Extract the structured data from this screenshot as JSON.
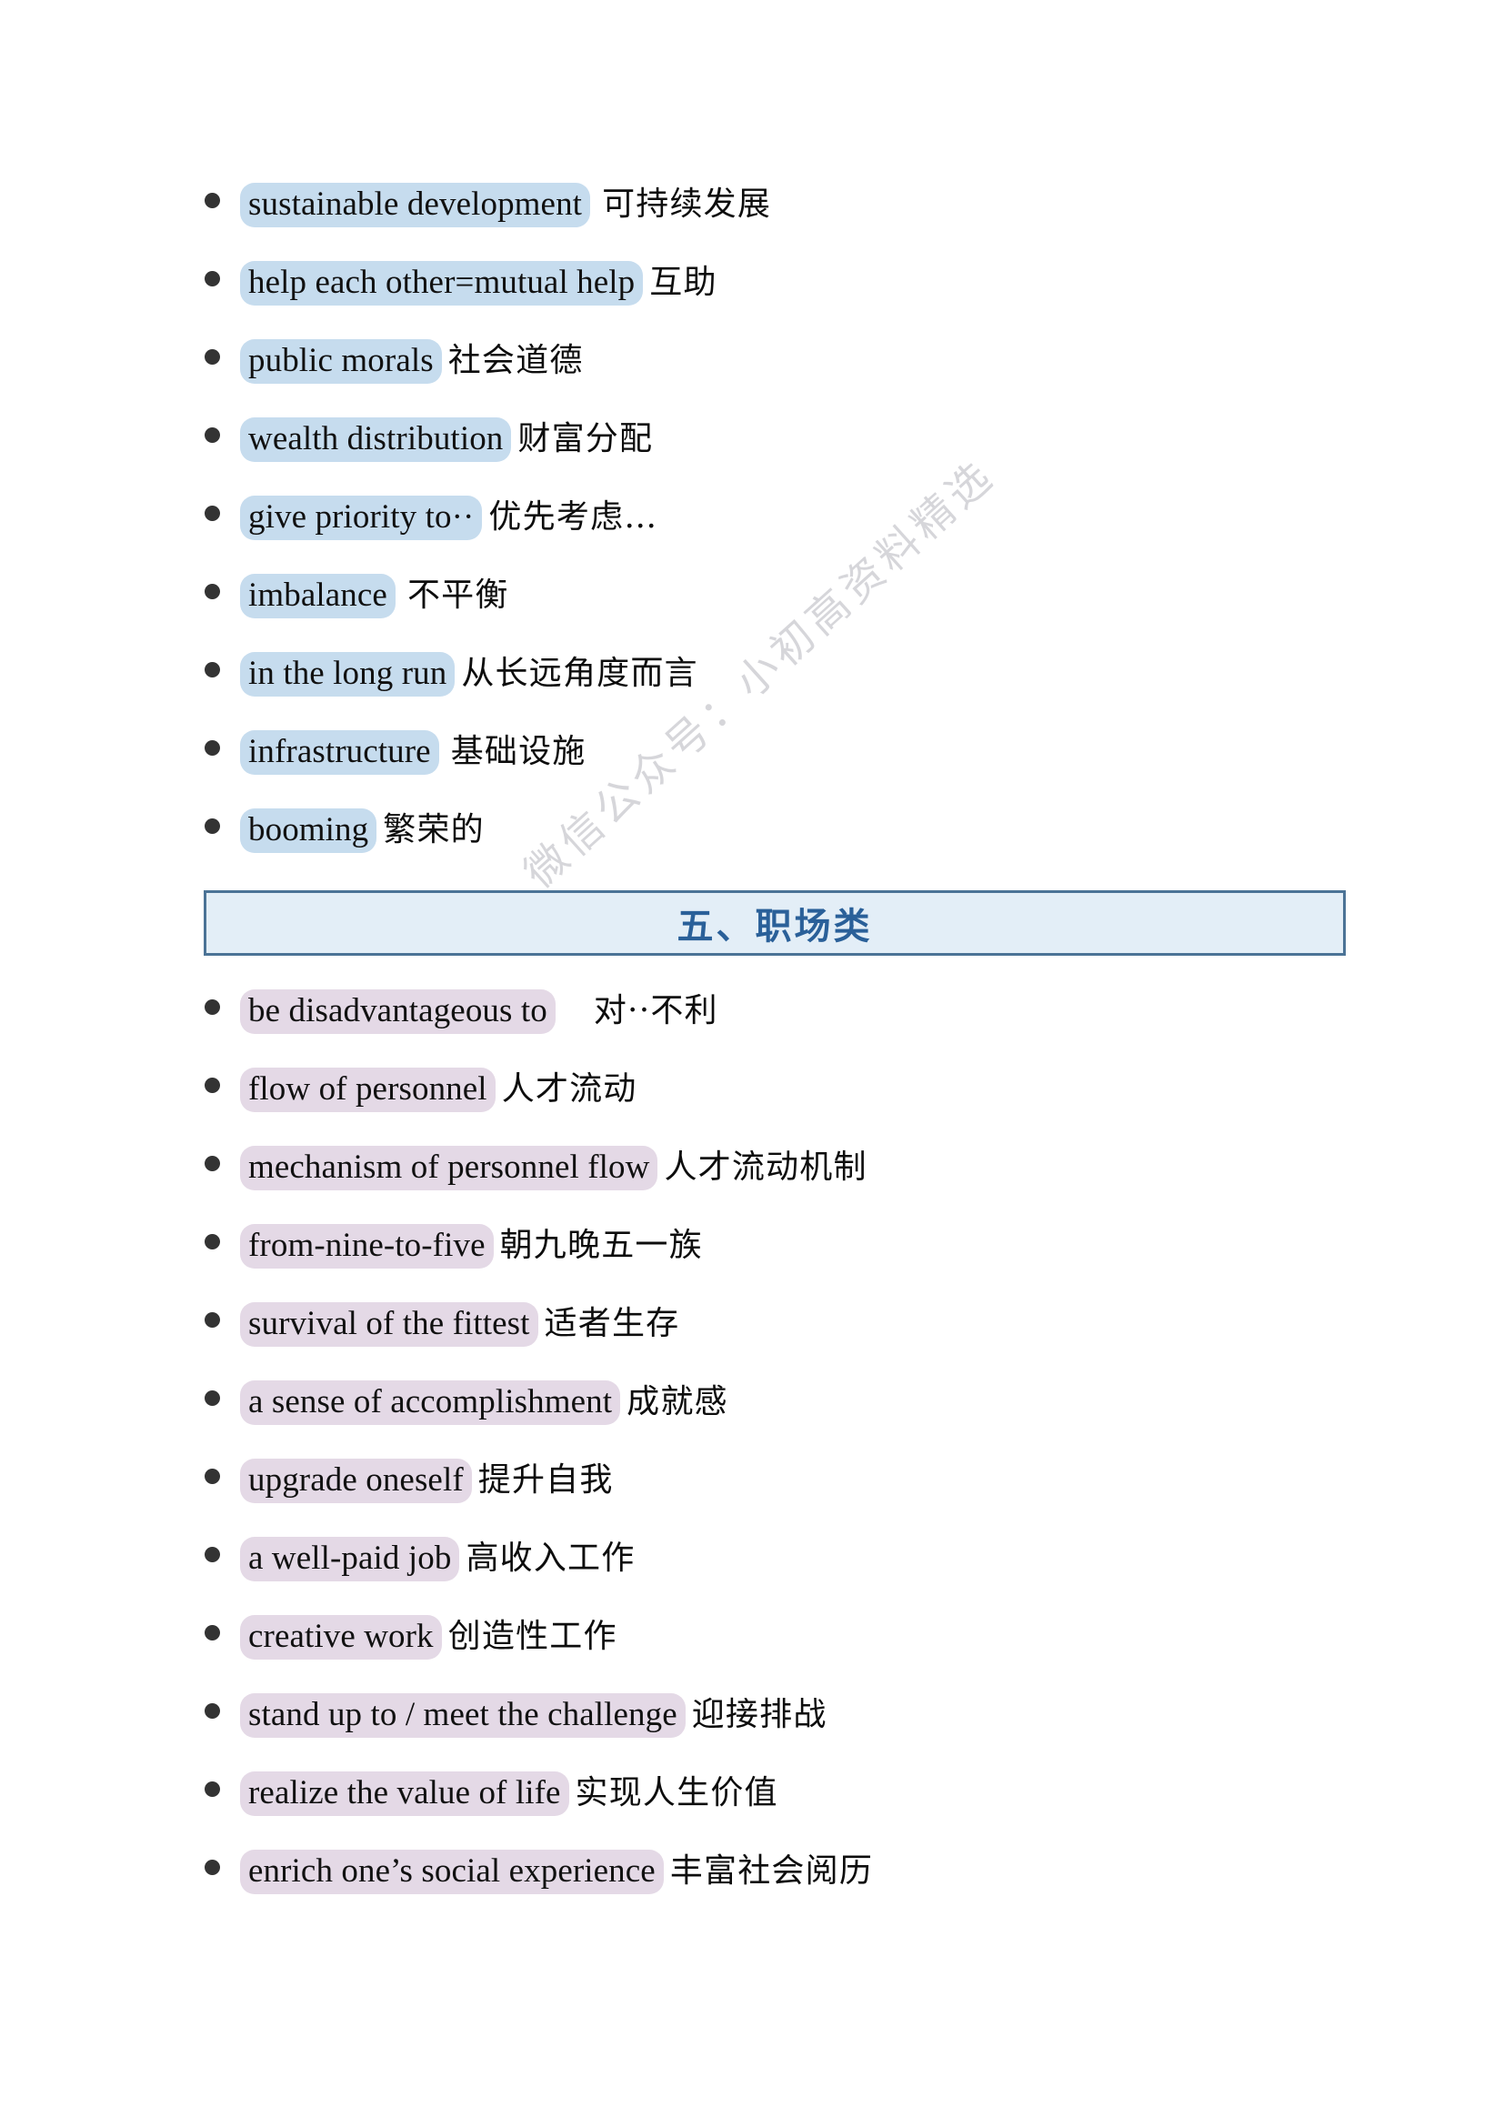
{
  "document": {
    "watermark": "微信公众号：小初高资料精选"
  },
  "section_one": {
    "items": [
      {
        "term": "sustainable development",
        "gloss": "可持续发展",
        "highlight": "blue",
        "gap": "normal"
      },
      {
        "term": "help each other=mutual help",
        "gloss": "互助",
        "highlight": "blue",
        "gap": "small"
      },
      {
        "term": "public morals",
        "gloss": "社会道德",
        "highlight": "blue",
        "gap": "small"
      },
      {
        "term": "wealth distribution",
        "gloss": "财富分配",
        "highlight": "blue",
        "gap": "small"
      },
      {
        "term": "give priority to··",
        "gloss": "优先考虑…",
        "highlight": "blue",
        "gap": "small"
      },
      {
        "term": "imbalance",
        "gloss": "不平衡",
        "highlight": "blue",
        "gap": "normal"
      },
      {
        "term": "in the long run",
        "gloss": "从长远角度而言",
        "highlight": "blue",
        "gap": "small"
      },
      {
        "term": "infrastructure",
        "gloss": "基础设施",
        "highlight": "blue",
        "gap": "normal"
      },
      {
        "term": "booming",
        "gloss": "繁荣的",
        "highlight": "blue",
        "gap": "small"
      }
    ]
  },
  "section_five": {
    "title": "五、职场类",
    "items": [
      {
        "term": "be disadvantageous to",
        "gloss": "对··不利",
        "highlight": "violet",
        "gap": "wide"
      },
      {
        "term": "flow of personnel",
        "gloss": "人才流动",
        "highlight": "violet",
        "gap": "small"
      },
      {
        "term": "mechanism of personnel flow",
        "gloss": "人才流动机制",
        "highlight": "violet",
        "gap": "small"
      },
      {
        "term": "from-nine-to-five",
        "gloss": "朝九晚五一族",
        "highlight": "violet",
        "gap": "small"
      },
      {
        "term": "survival of the fittest",
        "gloss": "适者生存",
        "highlight": "violet",
        "gap": "small"
      },
      {
        "term": "a sense of accomplishment",
        "gloss": "成就感",
        "highlight": "violet",
        "gap": "small"
      },
      {
        "term": "upgrade oneself",
        "gloss": "提升自我",
        "highlight": "violet",
        "gap": "small"
      },
      {
        "term": "a well-paid job",
        "gloss": "高收入工作",
        "highlight": "violet",
        "gap": "small"
      },
      {
        "term": "creative work",
        "gloss": "创造性工作",
        "highlight": "violet",
        "gap": "small"
      },
      {
        "term": "stand up to / meet the challenge",
        "gloss": "迎接排战",
        "highlight": "violet",
        "gap": "small"
      },
      {
        "term": "realize the value of life",
        "gloss": "实现人生价值",
        "highlight": "violet",
        "gap": "small"
      },
      {
        "term": "enrich one’s social experience",
        "gloss": "丰富社会阅历",
        "highlight": "violet",
        "gap": "small"
      }
    ]
  }
}
